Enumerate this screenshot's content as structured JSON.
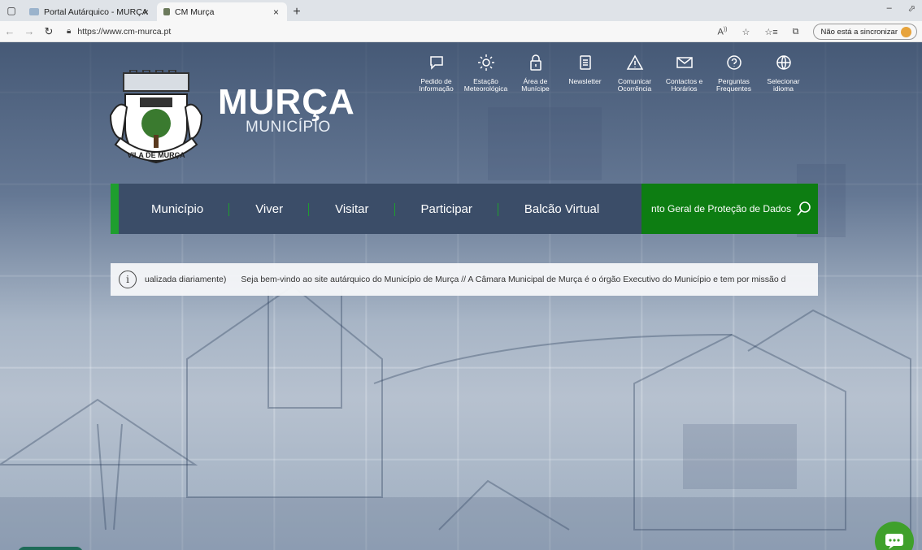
{
  "browser": {
    "tabs": [
      {
        "title": "Portal Autárquico - MURÇA",
        "close": "×"
      },
      {
        "title": "CM Murça",
        "close": "×"
      }
    ],
    "new_tab": "+",
    "url": "https://www.cm-murca.pt",
    "sync_label": "Não está a sincronizar",
    "window_min": "–",
    "window_extra": "⬀"
  },
  "header": {
    "brand_name": "MURÇA",
    "brand_sub": "MUNICÍPIO",
    "crest_text": "VILA DE MURÇA",
    "quick_links": [
      {
        "line1": "Pedido de",
        "line2": "Informação",
        "icon": "chat-bubble-icon"
      },
      {
        "line1": "Estação",
        "line2": "Meteorológica",
        "icon": "sun-icon"
      },
      {
        "line1": "Área de",
        "line2": "Munícipe",
        "icon": "lock-icon"
      },
      {
        "line1": "Newsletter",
        "line2": "",
        "icon": "newsletter-icon"
      },
      {
        "line1": "Comunicar",
        "line2": "Ocorrência",
        "icon": "warning-icon"
      },
      {
        "line1": "Contactos e",
        "line2": "Horários",
        "icon": "mail-icon"
      },
      {
        "line1": "Perguntas",
        "line2": "Frequentes",
        "icon": "question-icon"
      },
      {
        "line1": "Selecionar",
        "line2": "idioma",
        "icon": "globe-icon"
      }
    ]
  },
  "nav": {
    "items": [
      "Município",
      "Viver",
      "Visitar",
      "Participar",
      "Balcão Virtual"
    ],
    "search_text": "nto Geral de Proteção de Dados"
  },
  "ticker": {
    "info": "i",
    "text_a": "ualizada diariamente)",
    "text_b": "Seja bem-vindo ao site autárquico do Município de Murça // A Câmara Municipal de Murça é o órgão Executivo do Município e tem por missão d"
  },
  "colors": {
    "nav_bg": "#3b4d68",
    "accent_green": "#1e9e2e",
    "search_green": "#0d7d12",
    "chat_green": "#3fa02b"
  }
}
